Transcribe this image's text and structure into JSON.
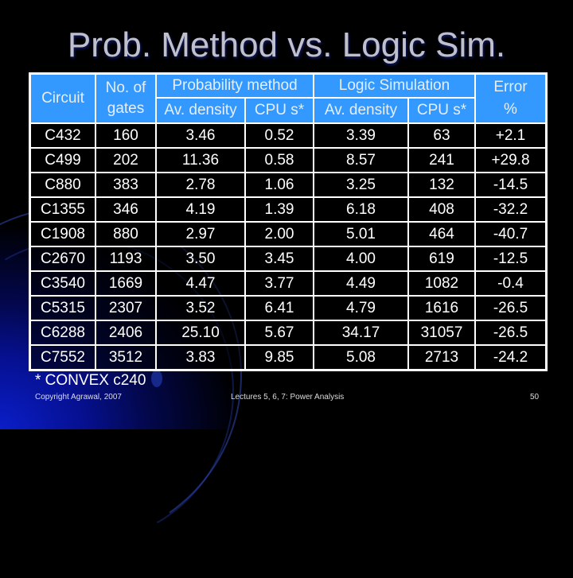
{
  "slide": {
    "title": "Prob. Method vs. Logic Sim.",
    "footnote": "* CONVEX c240",
    "footer_left": "Copyright Agrawal, 2007",
    "footer_center": "Lectures 5, 6, 7: Power Analysis",
    "page_number": "50"
  },
  "colors": {
    "header_bg": "#3399ff",
    "body_bg": "#000000",
    "title": "#c0c0cc",
    "accent_glow": "#0a1ec8"
  },
  "table": {
    "headers": {
      "circuit": "Circuit",
      "gates_line1": "No. of",
      "gates_line2": "gates",
      "prob_group": "Probability method",
      "logic_group": "Logic Simulation",
      "error_line1": "Error",
      "error_line2": "%",
      "av_density": "Av. density",
      "cpu": "CPU s*"
    },
    "rows": [
      [
        "C432",
        "160",
        "3.46",
        "0.52",
        "3.39",
        "63",
        "+2.1"
      ],
      [
        "C499",
        "202",
        "11.36",
        "0.58",
        "8.57",
        "241",
        "+29.8"
      ],
      [
        "C880",
        "383",
        "2.78",
        "1.06",
        "3.25",
        "132",
        "-14.5"
      ],
      [
        "C1355",
        "346",
        "4.19",
        "1.39",
        "6.18",
        "408",
        "-32.2"
      ],
      [
        "C1908",
        "880",
        "2.97",
        "2.00",
        "5.01",
        "464",
        "-40.7"
      ],
      [
        "C2670",
        "1193",
        "3.50",
        "3.45",
        "4.00",
        "619",
        "-12.5"
      ],
      [
        "C3540",
        "1669",
        "4.47",
        "3.77",
        "4.49",
        "1082",
        "-0.4"
      ],
      [
        "C5315",
        "2307",
        "3.52",
        "6.41",
        "4.79",
        "1616",
        "-26.5"
      ],
      [
        "C6288",
        "2406",
        "25.10",
        "5.67",
        "34.17",
        "31057",
        "-26.5"
      ],
      [
        "C7552",
        "3512",
        "3.83",
        "9.85",
        "5.08",
        "2713",
        "-24.2"
      ]
    ]
  }
}
